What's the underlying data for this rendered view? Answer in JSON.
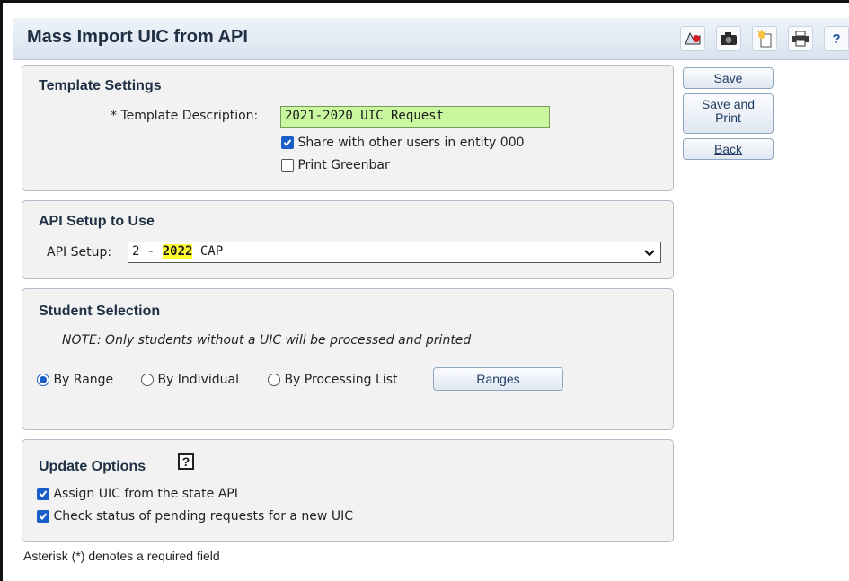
{
  "window": {
    "title": "Mass Import UIC from API"
  },
  "toolbar_icons": [
    "map-alert-icon",
    "camera-icon",
    "lightbulb-icon",
    "print-icon",
    "help-icon"
  ],
  "actions": {
    "save_label": "Save",
    "save_print_line1": "Save and",
    "save_print_line2": "Print",
    "back_label": "Back"
  },
  "template_settings": {
    "heading": "Template Settings",
    "description_label": "* Template Description:",
    "description_value": "2021-2020 UIC Request",
    "share_label": "Share with other users in entity 000",
    "share_checked": true,
    "greenbar_label": "Print Greenbar",
    "greenbar_checked": false
  },
  "api_setup": {
    "heading": "API Setup to Use",
    "label": "API Setup:",
    "value_prefix": "2 - ",
    "value_year": "2022",
    "value_suffix": " CAP"
  },
  "student_selection": {
    "heading": "Student Selection",
    "note": "NOTE: Only students without a UIC will be processed and printed",
    "options": [
      "By Range",
      "By Individual",
      "By Processing List"
    ],
    "selected": "By Range",
    "ranges_button": "Ranges"
  },
  "update_options": {
    "heading": "Update Options",
    "help_glyph": "?",
    "assign_label": "Assign UIC from the state API",
    "status_label": "Check status of pending requests for a new UIC"
  },
  "footer_note": "Asterisk (*) denotes a required field",
  "colors": {
    "input_highlight": "#c9f7a0",
    "year_highlight": "#ffff33",
    "accent": "#1a5fc8"
  }
}
